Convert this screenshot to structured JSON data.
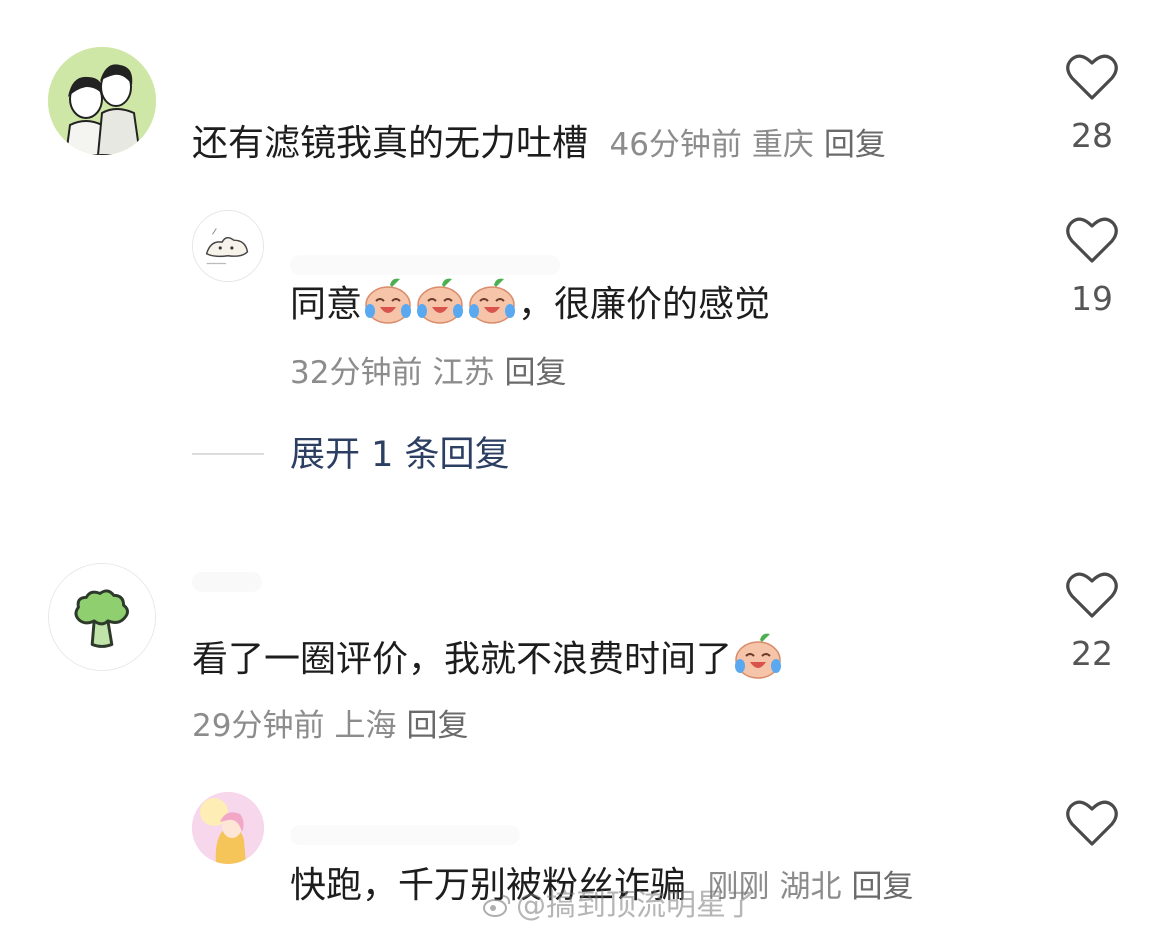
{
  "comments": [
    {
      "text": "还有滤镜我真的无力吐槽",
      "time": "46分钟前",
      "location": "重庆",
      "reply_label": "回复",
      "likes": "28",
      "avatar_icon": "couple-illustration-avatar"
    },
    {
      "text_before": "同意",
      "text_after": "，很廉价的感觉",
      "emoji_count": 3,
      "emoji_name": "crying-laughing-peach-emoji",
      "time": "32分钟前",
      "location": "江苏",
      "reply_label": "回复",
      "likes": "19",
      "avatar_icon": "dog-sketch-avatar"
    },
    {
      "text": "看了一圈评价，我就不浪费时间了",
      "emoji_name": "crying-laughing-peach-emoji",
      "time": "29分钟前",
      "location": "上海",
      "reply_label": "回复",
      "likes": "22",
      "avatar_icon": "broccoli-avatar"
    },
    {
      "text": "快跑，千万别被粉丝诈骗",
      "time": "刚刚",
      "location": "湖北",
      "reply_label": "回复",
      "avatar_icon": "pink-anime-avatar"
    }
  ],
  "expand_replies": "展开 1 条回复",
  "watermark": "@搞到顶流明星了",
  "colors": {
    "text": "#1d1d1d",
    "meta": "#8c8c8c",
    "expand_link": "#2c3f63",
    "icon": "#4a4a4a"
  }
}
